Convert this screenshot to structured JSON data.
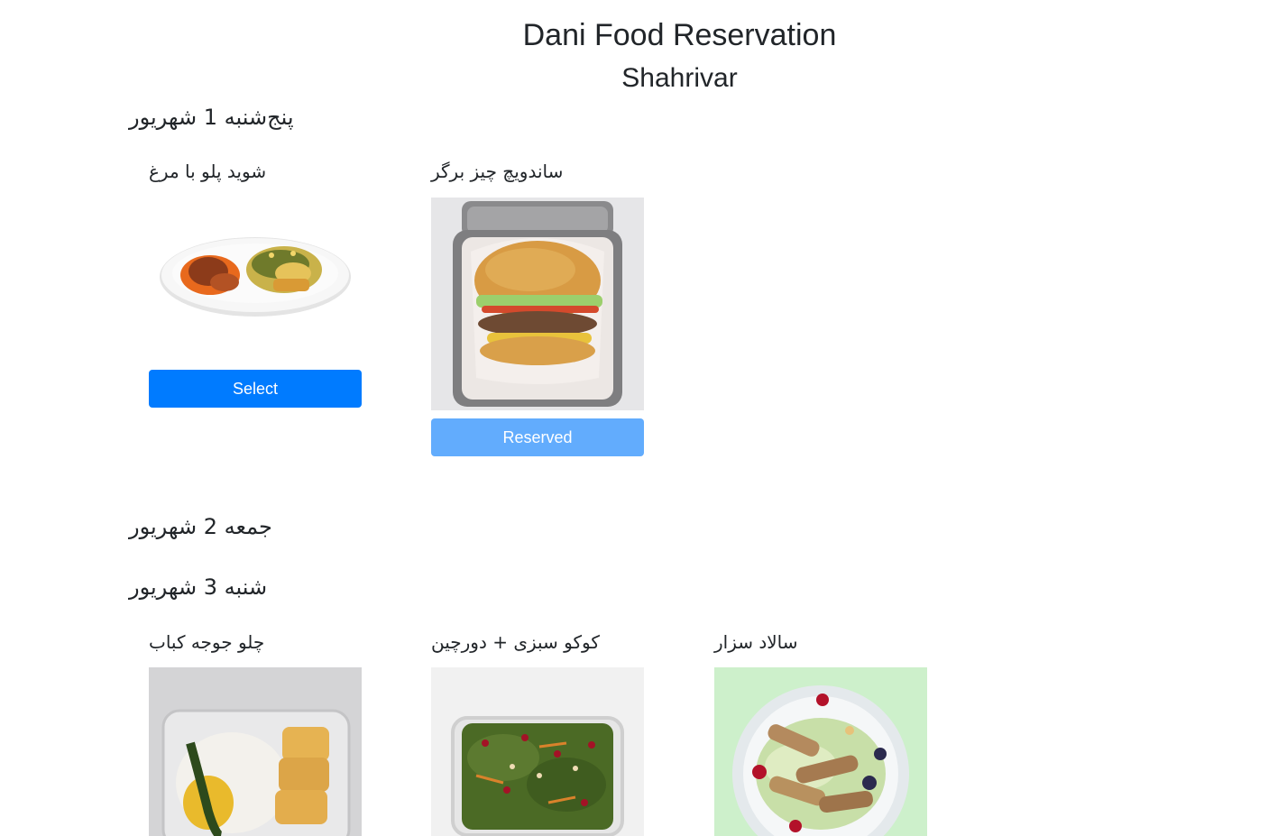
{
  "header": {
    "title": "Dani Food Reservation",
    "subtitle": "Shahrivar"
  },
  "days": [
    {
      "heading": "پنج‌شنبه 1 شهریور",
      "foods": [
        {
          "name": "شوید پلو با مرغ",
          "image_icon": "chicken-dill-rice-plate-image",
          "button_label": "Select",
          "status": "select"
        },
        {
          "name": "ساندویچ چیز برگر",
          "image_icon": "cheeseburger-box-image",
          "button_label": "Reserved",
          "status": "reserved"
        }
      ]
    },
    {
      "heading": "جمعه 2 شهریور",
      "foods": []
    },
    {
      "heading": "شنبه 3 شهریور",
      "foods": [
        {
          "name": "چلو جوجه کباب",
          "image_icon": "chicken-kebab-rice-image"
        },
        {
          "name": "کوکو سبزی + دورچین",
          "image_icon": "kuku-sabzi-tray-image"
        },
        {
          "name": "سالاد سزار",
          "image_icon": "caesar-salad-bowl-image"
        }
      ]
    }
  ],
  "colors": {
    "select_button": "#007bff",
    "reserved_button": "#62acfd",
    "salad_background": "#cdf0cb"
  }
}
